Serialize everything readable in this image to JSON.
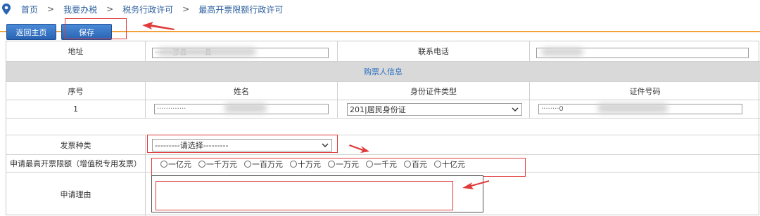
{
  "breadcrumb": [
    "首页",
    "我要办税",
    "税务行政许可",
    "最高开票限额行政许可"
  ],
  "toolbar": {
    "home_label": "返回主页",
    "save_label": "保存"
  },
  "form": {
    "address_label": "地址",
    "address_value": "········涉县········县",
    "phone_label": "联系电话",
    "buyer_section": "购票人信息",
    "columns": [
      "序号",
      "姓名",
      "身份证件类型",
      "证件号码"
    ],
    "buyer_row": {
      "index": "1",
      "name": "·············",
      "id_type": "201|居民身份证",
      "id_number": "········0"
    },
    "invoice_type_label": "发票种类",
    "invoice_type_value": "---------请选择---------",
    "limit_label": "申请最高开票限额（增值税专用发票）",
    "limit_options": [
      "一亿元",
      "一千万元",
      "一百万元",
      "十万元",
      "一万元",
      "一千元",
      "百元",
      "十亿元"
    ],
    "reason_label": "申请理由"
  },
  "icons": {
    "location": "map-pin-icon",
    "dropdown": "chevron-down-icon"
  },
  "colors": {
    "link": "#2a5d9c",
    "button": "#2a64b3",
    "accent_line": "#f2a23a",
    "highlight": "#e03a3a",
    "section_text": "#2a6fc0"
  }
}
